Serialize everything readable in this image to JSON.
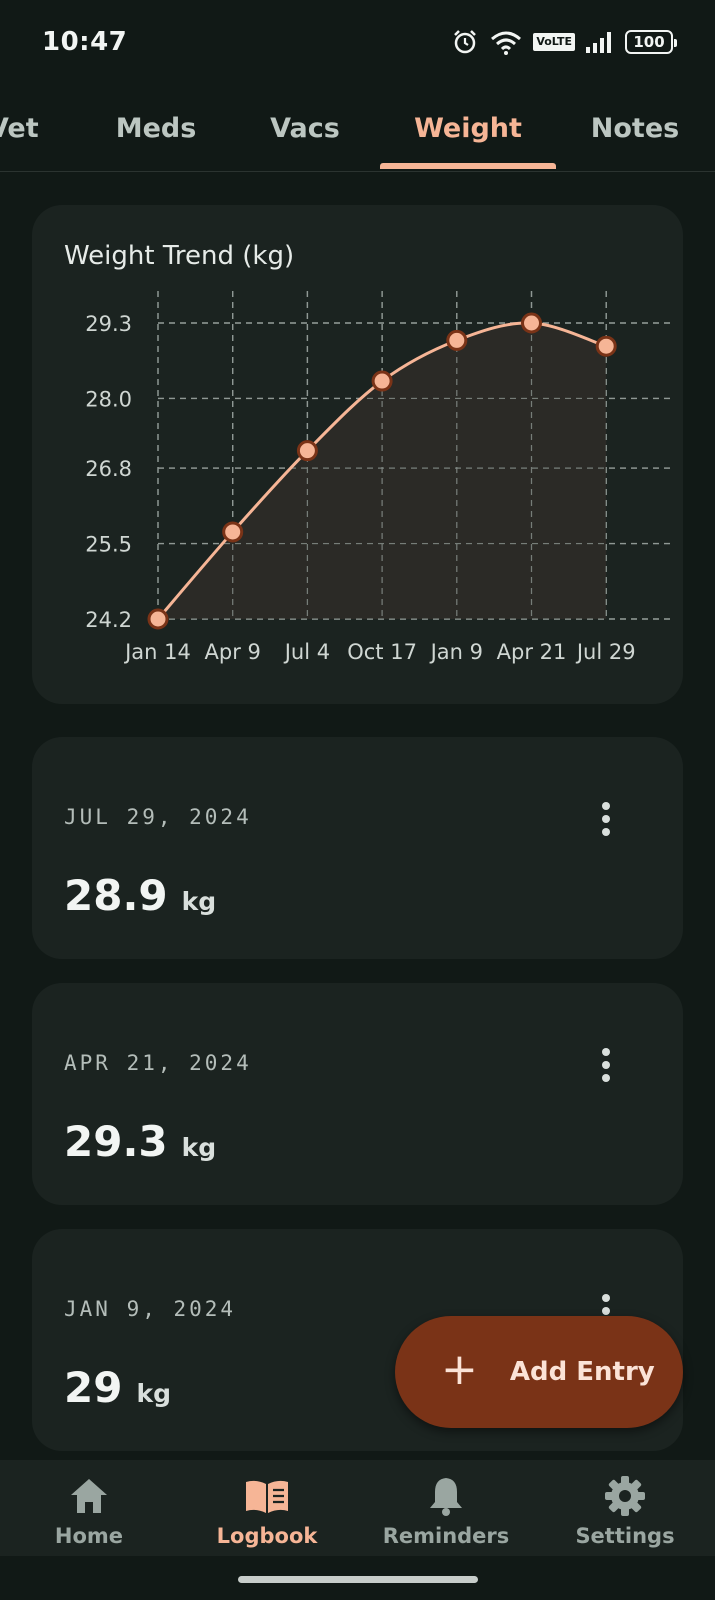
{
  "status": {
    "time": "10:47",
    "volte": "VoLTE",
    "battery": "100"
  },
  "tabs": [
    {
      "label": "Vet"
    },
    {
      "label": "Meds"
    },
    {
      "label": "Vacs"
    },
    {
      "label": "Weight",
      "active": true
    },
    {
      "label": "Notes"
    }
  ],
  "chart": {
    "title": "Weight Trend (kg)"
  },
  "chart_data": {
    "type": "line",
    "title": "Weight Trend (kg)",
    "categories": [
      "Jan 14",
      "Apr 9",
      "Jul 4",
      "Oct 17",
      "Jan 9",
      "Apr 21",
      "Jul 29"
    ],
    "values": [
      24.2,
      25.7,
      27.1,
      28.3,
      29.0,
      29.3,
      28.9
    ],
    "yticks": [
      "29.3",
      "28.0",
      "26.8",
      "25.5",
      "24.2"
    ],
    "ylim": [
      24.2,
      29.3
    ],
    "grid": true,
    "area_fill": true,
    "colors": {
      "line": "#f6b596",
      "marker_fill": "#f6b596",
      "marker_stroke": "#7a3317",
      "fill": "#2e2b28"
    }
  },
  "entries": [
    {
      "date": "JUL 29, 2024",
      "value": "28.9",
      "unit": "kg"
    },
    {
      "date": "APR 21, 2024",
      "value": "29.3",
      "unit": "kg"
    },
    {
      "date": "JAN 9, 2024",
      "value": "29",
      "unit": "kg"
    }
  ],
  "fab": {
    "label": "Add Entry",
    "icon": "plus-icon"
  },
  "nav": [
    {
      "label": "Home",
      "icon": "home-icon"
    },
    {
      "label": "Logbook",
      "icon": "book-icon",
      "active": true
    },
    {
      "label": "Reminders",
      "icon": "bell-icon"
    },
    {
      "label": "Settings",
      "icon": "gear-icon"
    }
  ],
  "colors": {
    "background": "#111916",
    "card": "#1b2320",
    "accent": "#f6b596",
    "fab": "#7a3317"
  }
}
